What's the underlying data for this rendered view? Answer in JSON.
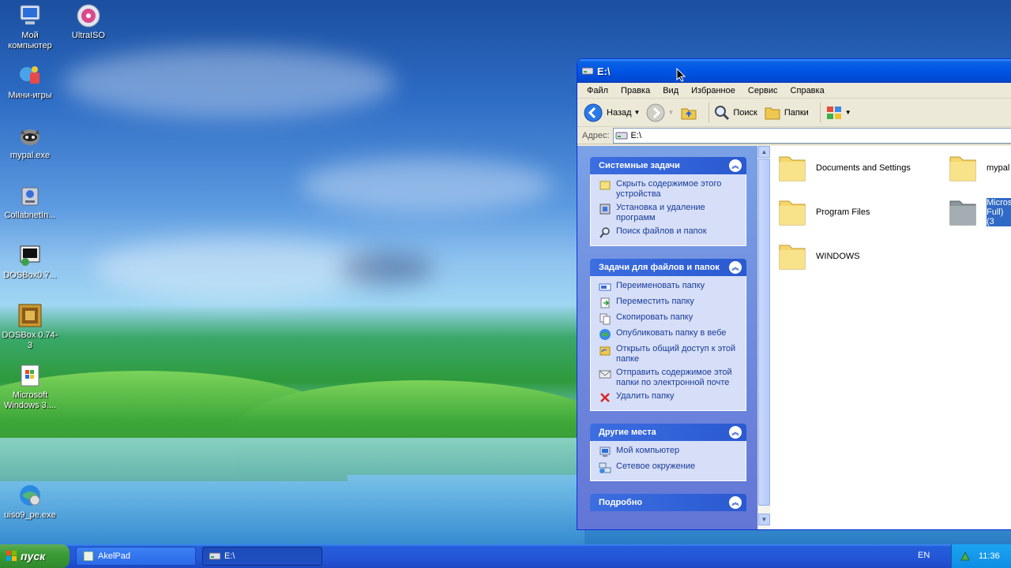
{
  "desktop": {
    "icons": [
      {
        "label": "Мой компьютер",
        "icon": "computer-icon"
      },
      {
        "label": "UltraISO",
        "icon": "disc-icon"
      },
      {
        "label": "Мини-игры",
        "icon": "games-icon"
      },
      {
        "label": "mypal.exe",
        "icon": "raccoon-icon"
      },
      {
        "label": "CollabnetIn...",
        "icon": "installer-icon"
      },
      {
        "label": "DOSBox0.7...",
        "icon": "dosbox-shortcut-icon"
      },
      {
        "label": "DOSBox 0.74-3",
        "icon": "dosbox-icon"
      },
      {
        "label": "Microsoft Windows 3....",
        "icon": "setup-icon"
      },
      {
        "label": "uiso9_pe.exe",
        "icon": "globe-cd-icon"
      }
    ]
  },
  "window": {
    "title": "E:\\",
    "menu": [
      "Файл",
      "Правка",
      "Вид",
      "Избранное",
      "Сервис",
      "Справка"
    ],
    "toolbar": {
      "back": "Назад",
      "search": "Поиск",
      "folders": "Папки"
    },
    "address": {
      "label": "Адрес:",
      "value": "E:\\"
    },
    "taskpane": {
      "system_tasks": {
        "title": "Системные задачи",
        "items": [
          "Скрыть содержимое этого устройства",
          "Установка и удаление программ",
          "Поиск файлов и папок"
        ]
      },
      "file_tasks": {
        "title": "Задачи для файлов и папок",
        "items": [
          "Переименовать папку",
          "Переместить папку",
          "Скопировать папку",
          "Опубликовать папку в вебе",
          "Открыть общий доступ к этой папке",
          "Отправить содержимое этой папки по электронной почте",
          "Удалить папку"
        ]
      },
      "other_places": {
        "title": "Другие места",
        "items": [
          "Мой компьютер",
          "Сетевое окружение"
        ]
      },
      "details": {
        "title": "Подробно"
      }
    },
    "files": [
      {
        "name": "Documents and Settings",
        "selected": false
      },
      {
        "name": "mypal",
        "selected": false
      },
      {
        "name": "Program Files",
        "selected": false
      },
      {
        "name": "Micros Full) (3",
        "selected": true
      },
      {
        "name": "WINDOWS",
        "selected": false
      }
    ]
  },
  "taskbar": {
    "start": "пуск",
    "tasks": [
      {
        "label": "AkelPad",
        "active": false
      },
      {
        "label": "E:\\",
        "active": true
      }
    ],
    "language": "EN",
    "clock": "11:36"
  },
  "colors": {
    "titlebar": "#0055e5",
    "taskpane": "#6375d6",
    "link": "#1a3a9a",
    "start": "#3c9b36",
    "selection": "#316ac5"
  }
}
